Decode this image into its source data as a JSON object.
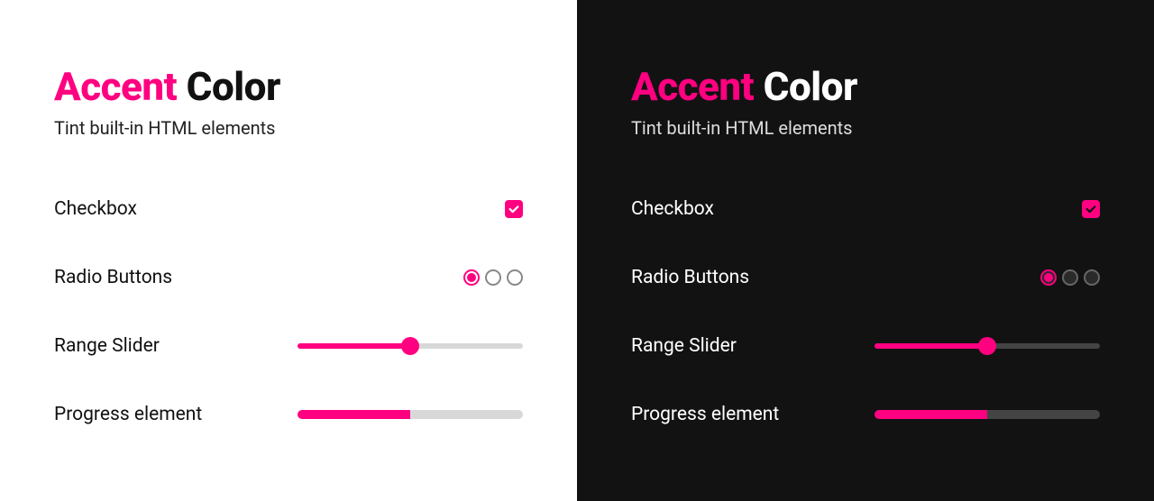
{
  "accent_color": "#ff0080",
  "heading": {
    "accent_word": "Accent",
    "rest_word": "Color"
  },
  "subheading": "Tint built-in HTML elements",
  "controls": {
    "checkbox": {
      "label": "Checkbox",
      "checked": true
    },
    "radio": {
      "label": "Radio Buttons",
      "options": 3,
      "selected_index": 0
    },
    "range": {
      "label": "Range Slider",
      "value": 50,
      "min": 0,
      "max": 100
    },
    "progress": {
      "label": "Progress element",
      "value": 50,
      "max": 100
    }
  }
}
